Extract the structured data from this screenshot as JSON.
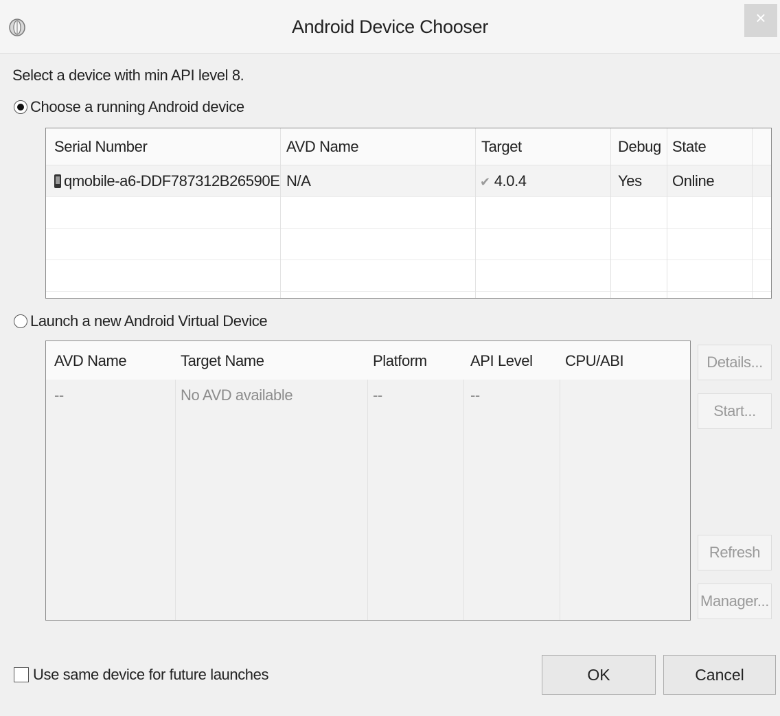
{
  "window": {
    "title": "Android Device Chooser",
    "close_glyph": "×"
  },
  "intro_text": "Select a device with min API level 8.",
  "running_section": {
    "label": "Choose a running Android device",
    "selected": true,
    "columns": [
      "Serial Number",
      "AVD Name",
      "Target",
      "Debug",
      "State"
    ],
    "rows": [
      {
        "icon": "phone-icon",
        "serial": "qmobile-a6-DDF787312B26590E",
        "avd_name": "N/A",
        "target_icon": "check-icon",
        "target": "4.0.4",
        "debug": "Yes",
        "state": "Online"
      }
    ]
  },
  "avd_section": {
    "label": "Launch a new Android Virtual Device",
    "selected": false,
    "columns": [
      "AVD Name",
      "Target Name",
      "Platform",
      "API Level",
      "CPU/ABI"
    ],
    "row": {
      "avd_name": "--",
      "target_name": "No AVD available",
      "platform": "--",
      "api_level": "--"
    },
    "buttons": {
      "details": "Details...",
      "start": "Start...",
      "refresh": "Refresh",
      "manager": "Manager..."
    }
  },
  "footer": {
    "checkbox_label": "Use same device for future launches",
    "checkbox_checked": false,
    "ok": "OK",
    "cancel": "Cancel"
  },
  "colors": {
    "dialog_bg": "#f0f0f0",
    "table_bg": "#ffffff",
    "disabled_text": "#9a9a9a"
  }
}
